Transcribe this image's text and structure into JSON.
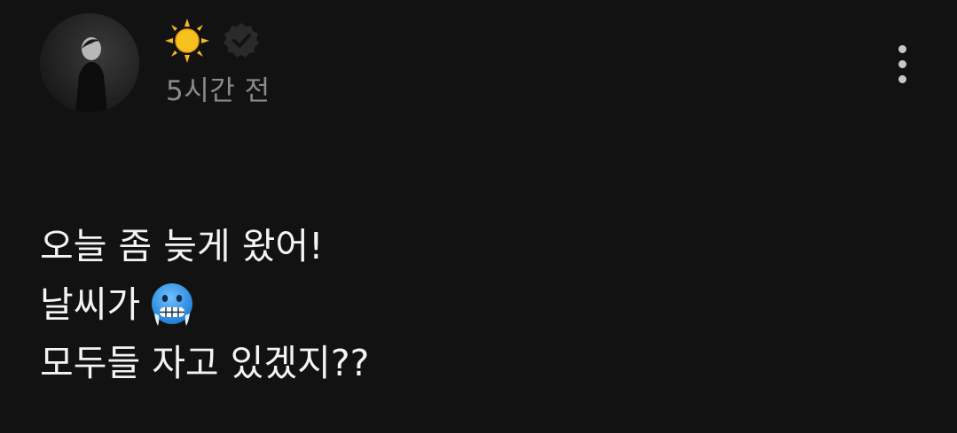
{
  "post": {
    "author": {
      "avatar_icon": "profile-photo",
      "name_icon": "sun-emoji",
      "badge_icon": "verified-badge-icon"
    },
    "timestamp": "5시간 전",
    "menu_icon": "more-vertical-icon",
    "lines": [
      {
        "text": "오늘 좀 늦게 왔어!"
      },
      {
        "text": "날씨가",
        "emoji": "cold-face-emoji"
      },
      {
        "text": "모두들 자고 있겠지??"
      }
    ]
  },
  "colors": {
    "background": "#121212",
    "text": "#f4f4f4",
    "muted": "#8a8a8a",
    "sun": "#f7b91d",
    "emoji_blue": "#3d9ee8"
  }
}
